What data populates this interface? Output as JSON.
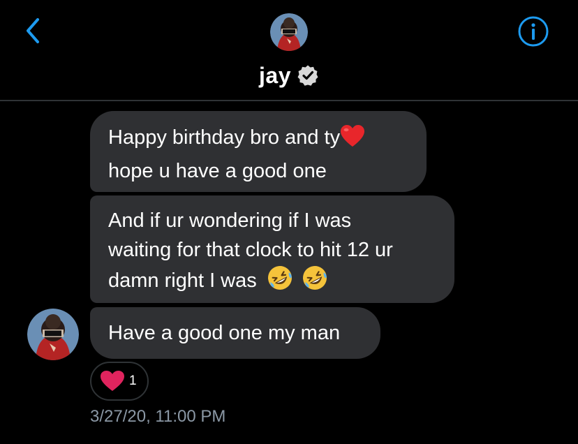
{
  "header": {
    "contact_name": "jay",
    "verified": true,
    "back_icon": "chevron-left-icon",
    "info_icon": "info-icon",
    "accent_color": "#1d9bf0"
  },
  "messages": [
    {
      "lines": [
        "Happy birthday bro and ty",
        "hope u have a good one"
      ],
      "trailing_emoji": "red-heart"
    },
    {
      "lines": [
        "And if ur wondering if I was",
        "waiting for that clock to hit 12 ur",
        "damn right I was"
      ],
      "trailing_emoji": "rolling-on-floor-laughing x2"
    },
    {
      "lines": [
        "Have a good one my man"
      ]
    }
  ],
  "reaction": {
    "emoji": "red-heart",
    "count": "1"
  },
  "timestamp": "3/27/20, 11:00 PM",
  "colors": {
    "background": "#000000",
    "bubble": "#2f3033",
    "divider": "#2f3336",
    "timestamp": "#8b98a5",
    "heart": "#e0245e"
  }
}
